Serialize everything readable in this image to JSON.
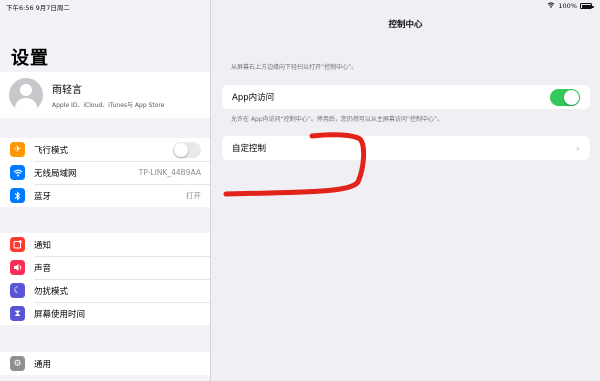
{
  "status_bar": {
    "time_date": "下午6:56  9月7日周二",
    "battery": "100%"
  },
  "sidebar": {
    "title": "设置",
    "profile": {
      "name": "雨轻言",
      "subtitle": "Apple ID、iCloud、iTunes与 App Store"
    },
    "groups": [
      {
        "items": [
          {
            "label": "飞行模式",
            "icon": "airplane-icon",
            "color": "#ff9500",
            "toggle": false
          },
          {
            "label": "无线局域网",
            "icon": "wifi-icon",
            "color": "#007aff",
            "value": "TP-LINK_44B9AA"
          },
          {
            "label": "蓝牙",
            "icon": "bluetooth-icon",
            "color": "#007aff",
            "value": "打开"
          }
        ]
      },
      {
        "items": [
          {
            "label": "通知",
            "icon": "notifications-icon",
            "color": "#ff3b30"
          },
          {
            "label": "声音",
            "icon": "speaker-icon",
            "color": "#ff2d55"
          },
          {
            "label": "勿扰模式",
            "icon": "moon-icon",
            "color": "#5856d6"
          },
          {
            "label": "屏幕使用时间",
            "icon": "hourglass-icon",
            "color": "#5856d6"
          }
        ]
      },
      {
        "items": [
          {
            "label": "通用",
            "icon": "gear-icon",
            "color": "#8e8e93"
          }
        ]
      }
    ]
  },
  "detail": {
    "title": "控制中心",
    "hint_top": "从屏幕右上方边缘向下轻扫以打开“控制中心”。",
    "app_access": {
      "label": "App内访问",
      "toggle": true
    },
    "hint_bottom": "允许在 App内访问“控制中心”。停用后，您仍然可以从主屏幕访问“控制中心”。",
    "customize": {
      "label": "自定控制"
    }
  },
  "annotation": {
    "color": "#e2231a"
  }
}
